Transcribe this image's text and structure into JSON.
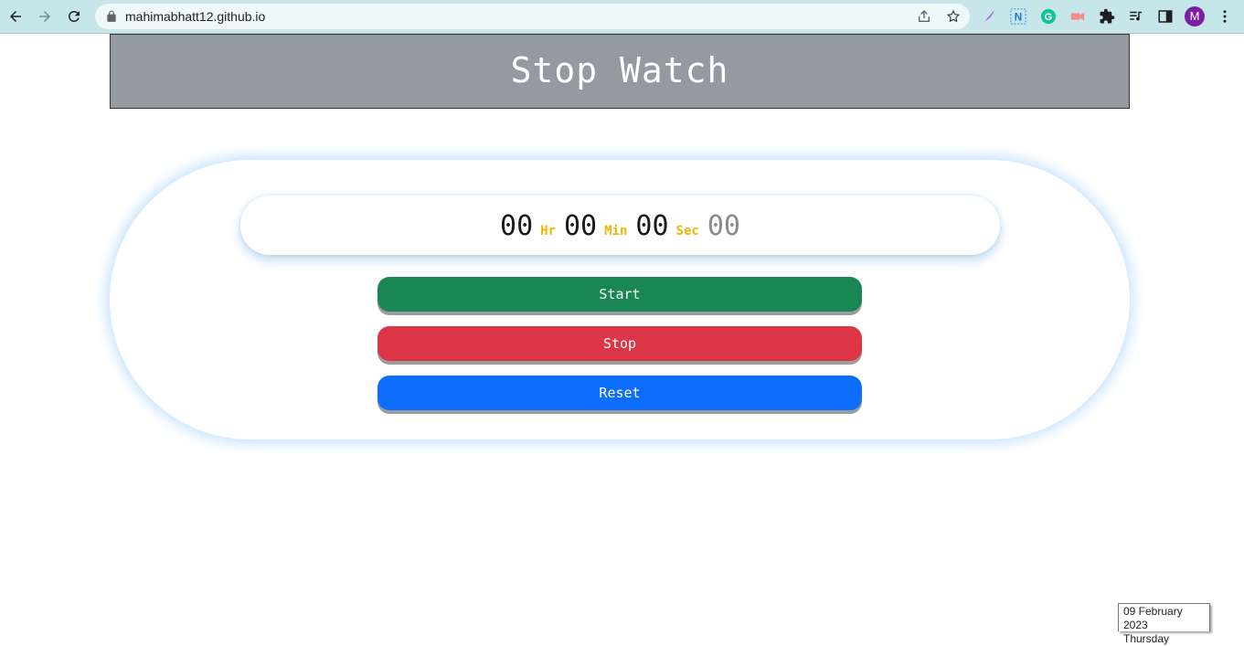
{
  "browser": {
    "url": "mahimabhatt12.github.io",
    "profile_initial": "M"
  },
  "icons": {
    "back": "back-arrow-icon",
    "forward": "forward-arrow-icon",
    "reload": "reload-icon",
    "lock": "lock-icon",
    "share": "share-icon",
    "bookmark": "star-icon",
    "extensions": [
      "quill-icon",
      "n-extension-icon",
      "grammarly-icon",
      "camera-extension-icon",
      "puzzle-icon",
      "media-control-icon",
      "side-panel-icon",
      "kebab-menu-icon"
    ]
  },
  "header": {
    "title": "Stop Watch"
  },
  "stopwatch": {
    "hours": "00",
    "hours_unit": "Hr",
    "minutes": "00",
    "minutes_unit": "Min",
    "seconds": "00",
    "seconds_unit": "Sec",
    "centiseconds": "00"
  },
  "buttons": {
    "start": "Start",
    "stop": "Stop",
    "reset": "Reset"
  },
  "colors": {
    "header_bg": "#939aa0",
    "unit_label": "#f3b400",
    "start": "#198754",
    "stop": "#dc3545",
    "reset": "#0d6efd",
    "glow": "#a4d2ff"
  },
  "taskbar_tooltip": {
    "date": "09 February 2023",
    "weekday": "Thursday"
  }
}
